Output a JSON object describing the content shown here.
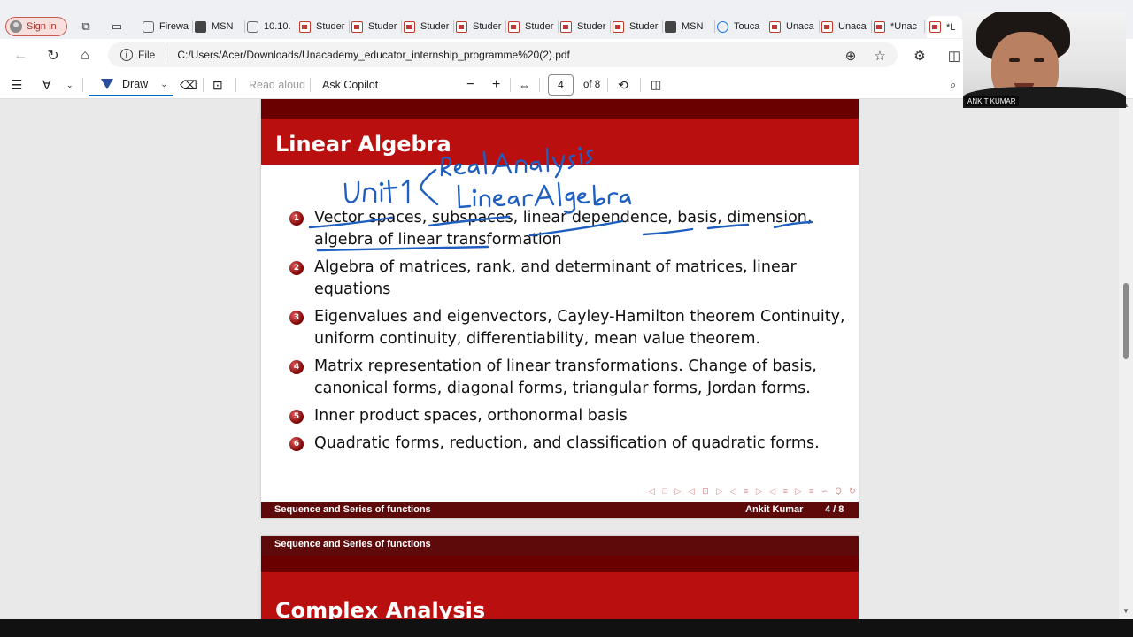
{
  "browser": {
    "signin_label": "Sign in",
    "tabs": [
      {
        "label": "Firewa",
        "icon": "generic-page-icon"
      },
      {
        "label": "MSN",
        "icon": "msn-icon"
      },
      {
        "label": "10.10.",
        "icon": "generic-page-icon"
      },
      {
        "label": "Studer",
        "icon": "pdf-icon"
      },
      {
        "label": "Studer",
        "icon": "pdf-icon"
      },
      {
        "label": "Studer",
        "icon": "pdf-icon"
      },
      {
        "label": "Studer",
        "icon": "pdf-icon"
      },
      {
        "label": "Studer",
        "icon": "pdf-icon"
      },
      {
        "label": "Studer",
        "icon": "pdf-icon"
      },
      {
        "label": "Studer",
        "icon": "pdf-icon"
      },
      {
        "label": "MSN",
        "icon": "msn-icon"
      },
      {
        "label": "Touca",
        "icon": "search-icon"
      },
      {
        "label": "Unaca",
        "icon": "pdf-icon"
      },
      {
        "label": "Unaca",
        "icon": "pdf-icon"
      },
      {
        "label": "*Unac",
        "icon": "pdf-icon"
      },
      {
        "label": "*L",
        "icon": "pdf-icon"
      }
    ],
    "active_tab": 15,
    "address": {
      "scheme_label": "File",
      "url": "C:/Users/Acer/Downloads/Unacademy_educator_internship_programme%20(2).pdf"
    }
  },
  "pdf_toolbar": {
    "draw_label": "Draw",
    "read_aloud_label": "Read aloud",
    "ask_copilot_label": "Ask Copilot",
    "page_current": "4",
    "page_total": "of 8"
  },
  "slide4": {
    "title": "Linear Algebra",
    "items": [
      {
        "num": "1",
        "text": "Vector spaces, subspaces, linear dependence, basis, dimension, algebra of linear transformation"
      },
      {
        "num": "2",
        "text": "Algebra of matrices, rank, and determinant of matrices, linear equations"
      },
      {
        "num": "3",
        "text": "Eigenvalues and eigenvectors, Cayley-Hamilton theorem Continuity, uniform continuity, differentiability, mean value theorem."
      },
      {
        "num": "4",
        "text": "Matrix representation of linear transformations. Change of basis, canonical forms, diagonal forms, triangular forms, Jordan forms."
      },
      {
        "num": "5",
        "text": "Inner product spaces, orthonormal basis"
      },
      {
        "num": "6",
        "text": "Quadratic forms, reduction, and classification of quadratic forms."
      }
    ],
    "footer_left": "Sequence and Series of functions",
    "footer_author": "Ankit Kumar",
    "footer_page": "4 / 8",
    "nav_symbols": "◁ □ ▷ ◁ ⊡ ▷ ◁ ≡ ▷ ◁ ≡ ▷ ≡ ∽ Q ↻"
  },
  "slide5": {
    "header": "Sequence and Series of functions",
    "title": "Complex Analysis"
  },
  "webcam": {
    "name": "ANKIT KUMAR"
  },
  "colors": {
    "slide_title_band": "#b90f0f",
    "slide_dark_band": "#6b0000",
    "footer_band": "#5e0a0a",
    "ink": "#1f5fbf",
    "signin_border": "#c9574d"
  }
}
